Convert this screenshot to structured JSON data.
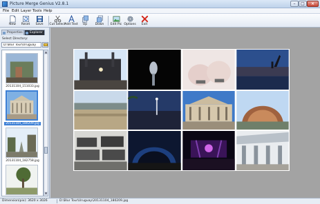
{
  "window": {
    "title": "Picture Merge Genius V2.8.1"
  },
  "menu": [
    "File",
    "Edit",
    "Layer",
    "Tools",
    "Help"
  ],
  "toolbar": {
    "new": "New",
    "reset": "Reset",
    "save": "Save",
    "cut_select": "Cut Select",
    "add_text": "Add Text",
    "up": "Up",
    "down": "Down",
    "edit_pic": "Edit Pic",
    "options": "Options",
    "exit": "Exit"
  },
  "panel": {
    "tabs": {
      "properties": "Properties",
      "explorer": "Explorer"
    },
    "select_directory_label": "Select Directory:",
    "directory_value": "D:\\Blur Tour\\Uruguay",
    "thumbnails": [
      {
        "caption": "20131104_151033.jpg"
      },
      {
        "caption": "20131104_180209.jpg"
      },
      {
        "caption": "20131104_182758.jpg"
      },
      {
        "caption": ""
      }
    ]
  },
  "status": {
    "dimension": "Dimension(pix): 3620 x 3026",
    "path": "D:\\Blur Tour\\Uruguay\\20131104_180209.jpg"
  },
  "colors": {
    "accent": "#3c7fd5",
    "canvas_bg": "#a3a3a3",
    "close_button": "#c74534"
  }
}
